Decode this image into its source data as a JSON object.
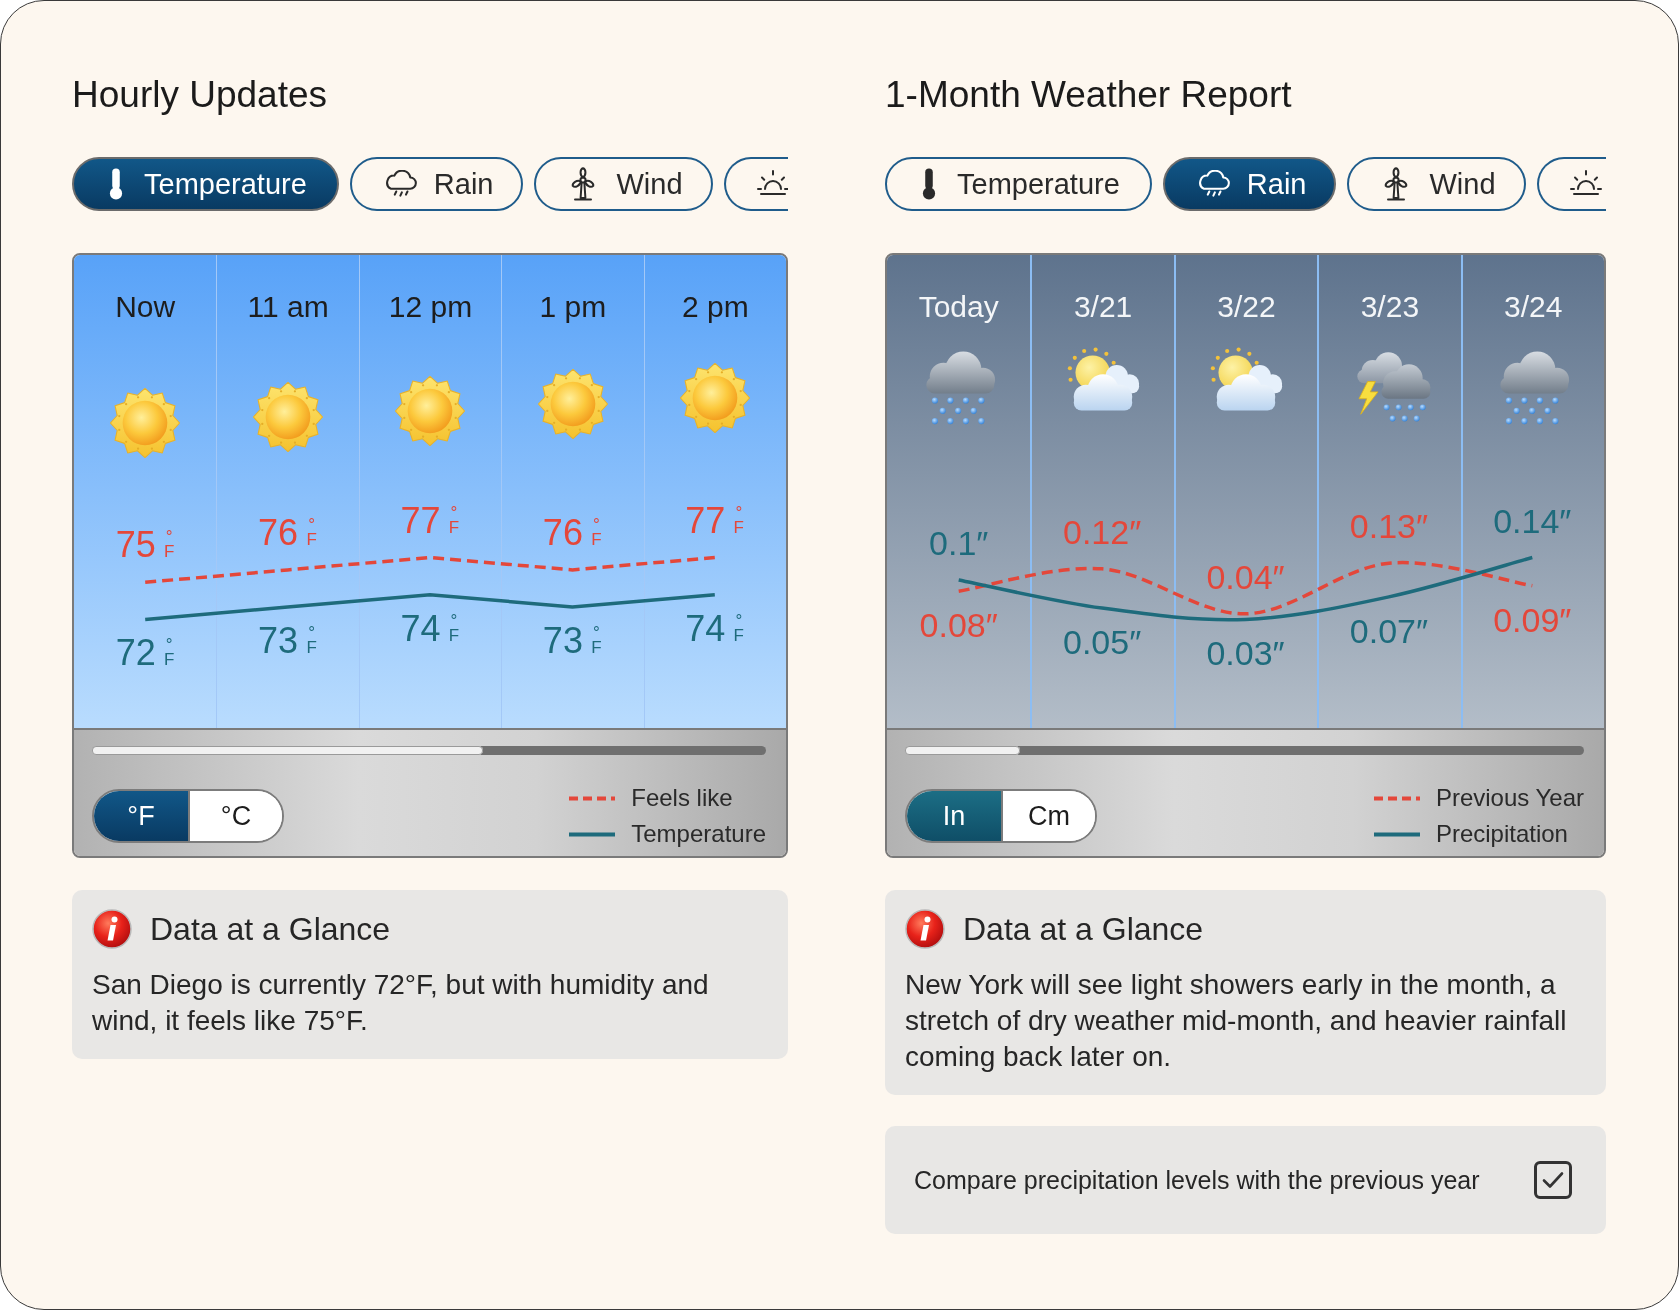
{
  "panels": [
    {
      "kind": "hourly",
      "title": "Hourly Updates",
      "tabs": [
        {
          "kind": "temperature",
          "label": "Temperature",
          "selected": true
        },
        {
          "kind": "rain",
          "label": "Rain",
          "selected": false
        },
        {
          "kind": "wind",
          "label": "Wind",
          "selected": false
        },
        {
          "kind": "uv",
          "selected": false
        }
      ],
      "chart": {
        "weather": [
          {
            "kind": "sunny"
          },
          {
            "kind": "sunny"
          },
          {
            "kind": "sunny"
          },
          {
            "kind": "sunny"
          },
          {
            "kind": "sunny"
          }
        ],
        "chart_data": {
          "type": "line",
          "categories": [
            "Now",
            "11 am",
            "12 pm",
            "1 pm",
            "2 pm"
          ],
          "series": [
            {
              "name": "Feels like",
              "color": "#e4473a",
              "line_style": "dashed",
              "values": [
                75,
                76,
                77,
                76,
                77
              ],
              "value_labels": [
                "75°F",
                "76°F",
                "77°F",
                "76°F",
                "77°F"
              ]
            },
            {
              "name": "Temperature",
              "color": "#1e6b7c",
              "line_style": "solid",
              "values": [
                72,
                73,
                74,
                73,
                74
              ],
              "value_labels": [
                "72°F",
                "73°F",
                "74°F",
                "73°F",
                "74°F"
              ]
            }
          ]
        }
      },
      "units": [
        {
          "label": "°F",
          "selected": true
        },
        {
          "label": "°C",
          "selected": false
        }
      ],
      "info": {
        "title": "Data at a Glance",
        "text": "San Diego is currently 72°F, but with humidity and wind, it feels like 75°F."
      }
    },
    {
      "kind": "monthly",
      "title": "1-Month Weather Report",
      "tabs": [
        {
          "kind": "temperature",
          "label": "Temperature",
          "selected": false
        },
        {
          "kind": "rain",
          "label": "Rain",
          "selected": true
        },
        {
          "kind": "wind",
          "label": "Wind",
          "selected": false
        },
        {
          "kind": "uv",
          "selected": false
        }
      ],
      "chart": {
        "weather": [
          {
            "kind": "rain"
          },
          {
            "kind": "partly-cloudy"
          },
          {
            "kind": "partly-cloudy"
          },
          {
            "kind": "thunderstorm"
          },
          {
            "kind": "rain"
          }
        ],
        "chart_data": {
          "type": "line",
          "categories": [
            "Today",
            "3/21",
            "3/22",
            "3/23",
            "3/24"
          ],
          "series": [
            {
              "name": "Previous Year",
              "color": "#e4473a",
              "line_style": "dashed",
              "values": [
                0.08,
                0.12,
                0.04,
                0.13,
                0.09
              ],
              "value_labels": [
                "0.08″",
                "0.12″",
                "0.04″",
                "0.13″",
                "0.09″"
              ]
            },
            {
              "name": "Precipitation",
              "color": "#1e6b7c",
              "line_style": "solid",
              "values": [
                0.1,
                0.05,
                0.03,
                0.07,
                0.14
              ],
              "value_labels": [
                "0.1″",
                "0.05″",
                "0.03″",
                "0.07″",
                "0.14″"
              ]
            }
          ]
        }
      },
      "units": [
        {
          "label": "In",
          "selected": true
        },
        {
          "label": "Cm",
          "selected": false
        }
      ],
      "info": {
        "title": "Data at a Glance",
        "text": "New York will see light showers early in the month, a stretch of dry weather mid-month, and heavier rainfall coming back later on."
      },
      "compare_option": {
        "label": "Compare precipitation levels with the previous year",
        "checked": true
      }
    }
  ]
}
